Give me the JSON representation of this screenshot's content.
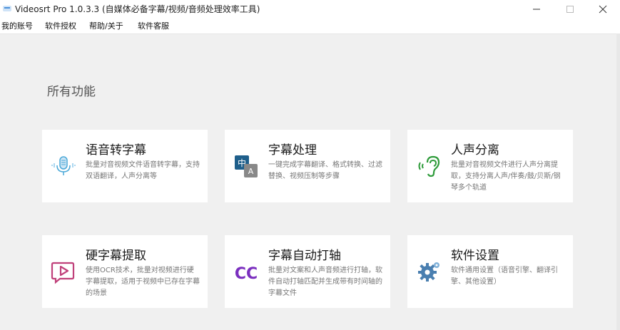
{
  "window": {
    "title": "Videosrt Pro 1.0.3.3   (自媒体必备字幕/视频/音频处理效率工具)"
  },
  "menu": {
    "items": [
      "我的账号",
      "软件授权",
      "帮助/关于",
      "软件客服"
    ]
  },
  "main": {
    "section_title": "所有功能",
    "cards": [
      {
        "title": "语音转字幕",
        "desc": "批量对音视频文件语音转字幕，支持双语翻译，人声分离等",
        "icon": "microphone-icon",
        "accent": "#4aa8d8"
      },
      {
        "title": "字幕处理",
        "desc": "一键完成字幕翻译、格式转换、过滤替换、视频压制等步骤",
        "icon": "translate-icon",
        "accent": "#1f5f8b"
      },
      {
        "title": "人声分离",
        "desc": "批量对音视频文件进行人声分离提取，支持分离人声/伴奏/鼓/贝斯/钢琴多个轨道",
        "icon": "hearing-icon",
        "accent": "#2e9b3a"
      },
      {
        "title": "硬字幕提取",
        "desc": "使用OCR技术，批量对视频进行硬字幕提取，适用于视频中已存在字幕的场景",
        "icon": "play-bubble-icon",
        "accent": "#c0407a"
      },
      {
        "title": "字幕自动打轴",
        "desc": "批量对文案和人声音频进行打轴，软件自动打轴匹配并生成带有时间轴的字幕文件",
        "icon": "cc-icon",
        "accent": "#7b2fbf"
      },
      {
        "title": "软件设置",
        "desc": "软件通用设置（语音引擎、翻译引擎、其他设置）",
        "icon": "gear-icon",
        "accent": "#4a7fb0"
      }
    ]
  }
}
